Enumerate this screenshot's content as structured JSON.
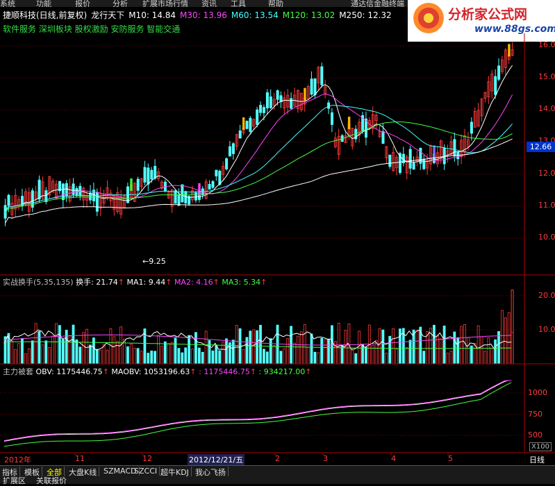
{
  "menu": [
    "系统",
    "功能",
    "报价",
    "分析",
    "扩展市场行情",
    "资讯",
    "工具",
    "帮助"
  ],
  "promo": "通达信金融终端",
  "logo": {
    "name": "分析家公式网",
    "url": "www.88gs.com"
  },
  "header": {
    "stock": "捷顺科技(日线,前复权)",
    "label": "龙行天下",
    "ma": [
      {
        "text": "M10: 14.84",
        "color": "#ffffff"
      },
      {
        "text": "M30: 13.96",
        "color": "#ff44ff"
      },
      {
        "text": "M60: 13.54",
        "color": "#44ffff"
      },
      {
        "text": "M120: 13.02",
        "color": "#44ff44"
      },
      {
        "text": "M250: 12.32",
        "color": "#ffffff"
      }
    ],
    "sectors": "软件服务 深圳板块 股权激励 安防服务 智能交通"
  },
  "price_axis": [
    "16.0",
    "15.0",
    "14.0",
    "13.0",
    "12.0",
    "11.0",
    "10.0"
  ],
  "current_price": "12.66",
  "low_label": "9.25",
  "indicator1": {
    "name": "实战换手(5,35,135)",
    "items": [
      {
        "text": "换手: 21.74",
        "color": "#ffffff"
      },
      {
        "text": "MA1: 9.44",
        "color": "#ffffff"
      },
      {
        "text": "MA2: 4.16",
        "color": "#ff44ff"
      },
      {
        "text": "MA3: 5.34",
        "color": "#44ff44"
      }
    ],
    "axis": [
      "20.0",
      "10.0"
    ]
  },
  "indicator2": {
    "name": "主力被套",
    "items": [
      {
        "text": "OBV: 1175446.75",
        "color": "#ffffff"
      },
      {
        "text": "MAOBV: 1053196.63",
        "color": "#ffffff"
      },
      {
        "text": ": 1175446.75",
        "color": "#ff44ff"
      },
      {
        "text": ": 934217.00",
        "color": "#44ff44"
      }
    ],
    "axis": [
      "1000",
      "750",
      "500"
    ],
    "scale": "X100"
  },
  "time_axis": [
    "2012年",
    "11",
    "12",
    "2012/12/21/五",
    "2",
    "3",
    "4",
    "5"
  ],
  "period": "日线",
  "tabs": [
    "指标",
    "模板",
    "全部",
    "大盘K线",
    "SZMACD",
    "SZCCI",
    "超牛KDJ",
    "我心飞扬"
  ],
  "active_tab": "全部",
  "bottom": [
    "扩展区",
    "关联报价"
  ],
  "colors": {
    "up": "#ff3b3b",
    "down": "#54ffff",
    "grid": "#8b0000",
    "accent": "#ffb400"
  }
}
